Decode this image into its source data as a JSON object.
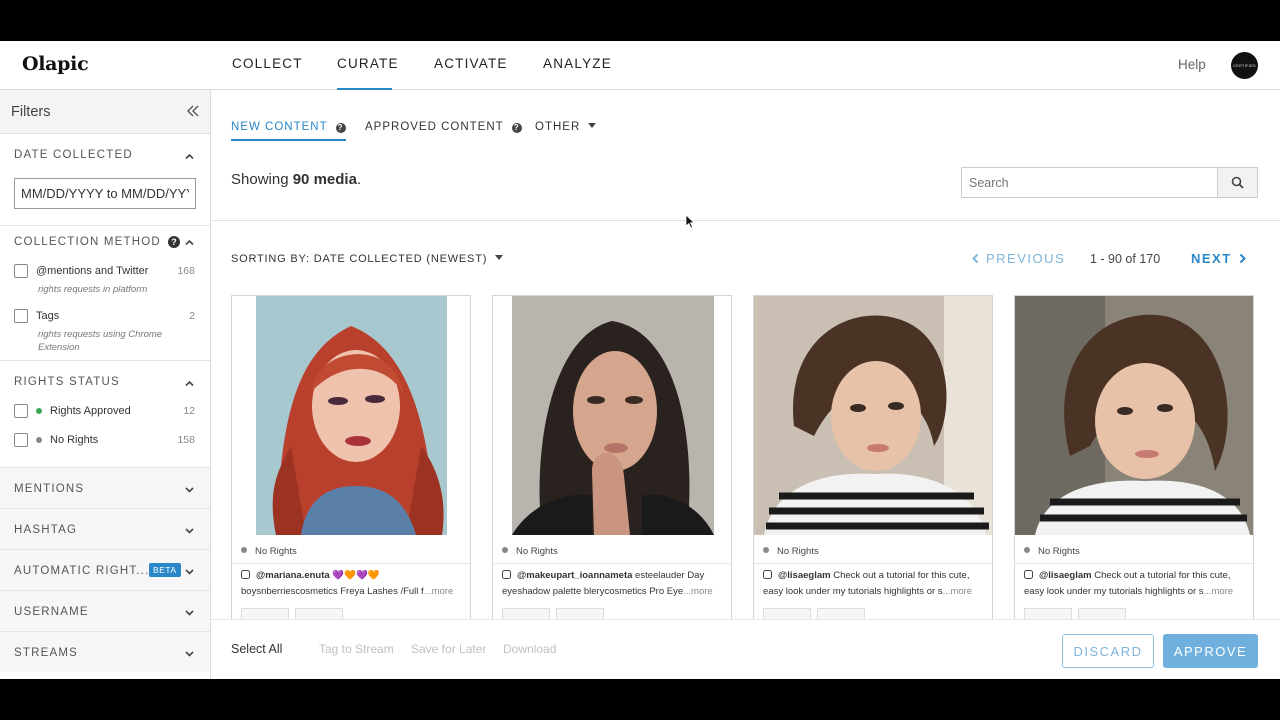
{
  "app": {
    "logo": "Olapic"
  },
  "nav": {
    "items": [
      "COLLECT",
      "CURATE",
      "ACTIVATE",
      "ANALYZE"
    ],
    "active": "CURATE",
    "help": "Help",
    "avatar_text": "CERTIFIED"
  },
  "sidebar": {
    "title": "Filters",
    "date_collected": {
      "title": "DATE COLLECTED",
      "placeholder": "MM/DD/YYYY to MM/DD/YYYY"
    },
    "collection_method": {
      "title": "COLLECTION METHOD",
      "options": [
        {
          "label": "@mentions and Twitter",
          "sub": "rights requests in platform",
          "count": "168"
        },
        {
          "label": "Tags",
          "sub": "rights requests using Chrome Extension",
          "count": "2"
        }
      ]
    },
    "rights_status": {
      "title": "RIGHTS STATUS",
      "options": [
        {
          "label": "Rights Approved",
          "count": "12",
          "color": "#3aa457"
        },
        {
          "label": "No Rights",
          "count": "158",
          "color": "#888888"
        }
      ]
    },
    "collapsed_sections": [
      "MENTIONS",
      "HASHTAG",
      "AUTOMATIC RIGHT...",
      "USERNAME",
      "STREAMS"
    ],
    "beta_badge": "BETA"
  },
  "main": {
    "tabs": [
      {
        "label": "NEW CONTENT",
        "help": "?"
      },
      {
        "label": "APPROVED CONTENT",
        "help": "?"
      },
      {
        "label": "OTHER"
      }
    ],
    "showing_prefix": "Showing ",
    "showing_count": "90 media",
    "showing_suffix": ".",
    "search_placeholder": "Search",
    "sorting": "SORTING BY: DATE COLLECTED (NEWEST)",
    "previous": "PREVIOUS",
    "pager": "1 - 90 of 170",
    "next": "NEXT",
    "cards": [
      {
        "status": "No Rights",
        "user": "@mariana.enuta",
        "emoji": "💜🧡💜🧡",
        "text": "boysnberriescosmetics Freya Lashes /Full f",
        "more": "...more"
      },
      {
        "status": "No Rights",
        "user": "@makeupart_ioannameta",
        "text": "esteelauder Day eyeshadow palette blerycosmetics Pro Eye",
        "more": "...more"
      },
      {
        "status": "No Rights",
        "user": "@lisaeglam",
        "text": "Check out a tutorial for this cute, easy look under my tutorials highlights or s",
        "more": "...more"
      },
      {
        "status": "No Rights",
        "user": "@lisaeglam",
        "text": "Check out a tutorial for this cute, easy look under my tutorials highlights or s",
        "more": "...more"
      }
    ]
  },
  "bottom": {
    "select_all": "Select All",
    "tag_to_stream": "Tag to Stream",
    "save_for_later": "Save for Later",
    "download": "Download",
    "discard": "DISCARD",
    "approve": "APPROVE"
  },
  "colors": {
    "accent": "#2a87c8",
    "approve_bg": "#6fb0df"
  }
}
